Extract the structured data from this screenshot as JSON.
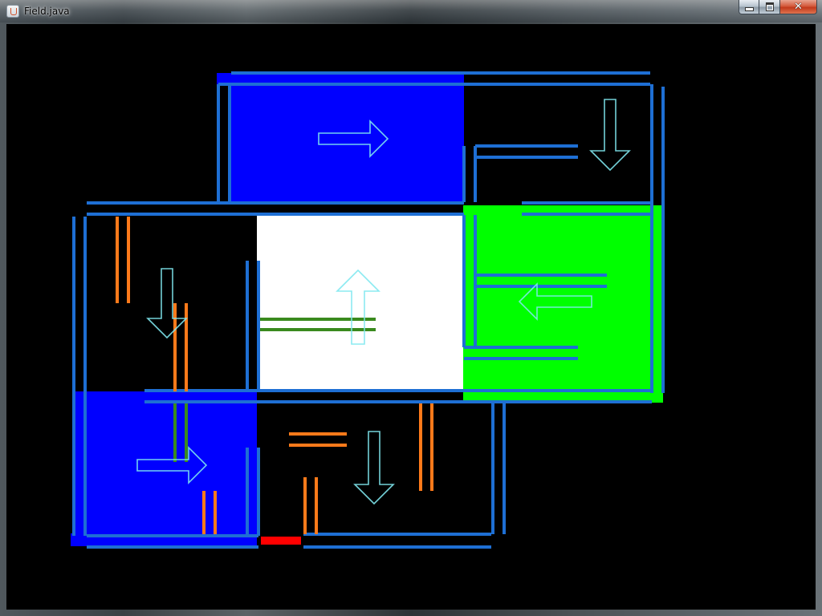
{
  "window": {
    "title": "Field.java"
  },
  "icons": {
    "app": "java-cup-icon",
    "minimize": "minimize-icon",
    "maximize": "maximize-icon",
    "close": "close-icon"
  },
  "field": {
    "background": "#000000",
    "rooms": [
      {
        "id": "top-room",
        "fill": "#0000ff",
        "arrow": "right"
      },
      {
        "id": "top-right-room",
        "fill": "#000000",
        "arrow": "down"
      },
      {
        "id": "left-room",
        "fill": "#000000",
        "arrow": "down"
      },
      {
        "id": "center-room",
        "fill": "#ffffff",
        "arrow": "up"
      },
      {
        "id": "right-room",
        "fill": "#00ff00",
        "arrow": "left"
      },
      {
        "id": "bottom-left-room",
        "fill": "#0000ff",
        "arrow": "right"
      },
      {
        "id": "bottom-room",
        "fill": "#000000",
        "arrow": "down"
      }
    ],
    "colors": {
      "wall": "#1e6fd4",
      "blue": "#0000ff",
      "green": "#00ff00",
      "white": "#ffffff",
      "orange": "#ff7a1a",
      "green_bar": "#3a8a1e",
      "arrow": "#7fe8f0",
      "exit": "#ff0000"
    }
  }
}
